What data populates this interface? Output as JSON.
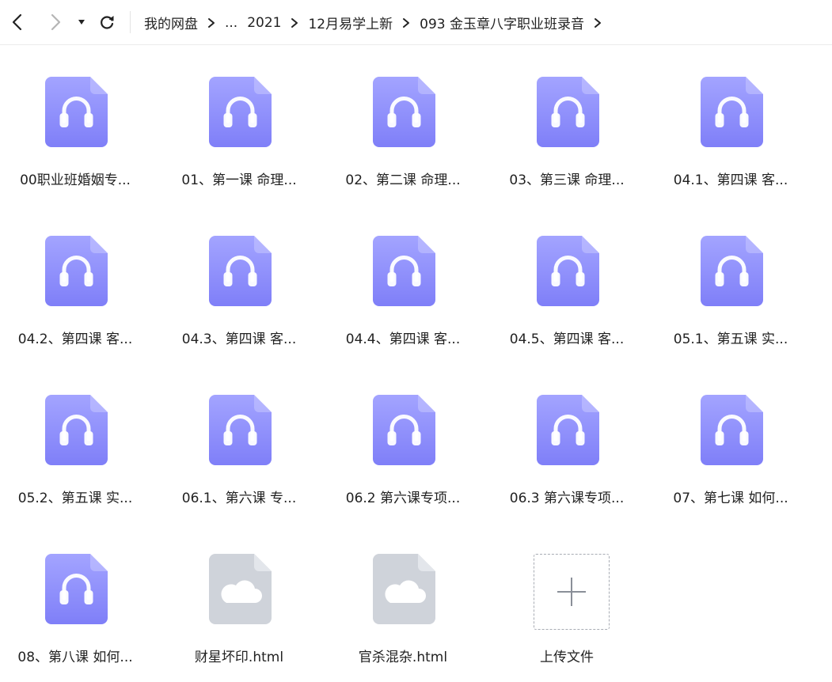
{
  "toolbar": {
    "breadcrumb": {
      "root": "我的网盘",
      "ellipsis": "...",
      "items": [
        "2021",
        "12月易学上新",
        "093 金玉章八字职业班录音"
      ]
    }
  },
  "files": [
    {
      "name": "00职业班婚姻专...",
      "type": "audio"
    },
    {
      "name": "01、第一课 命理...",
      "type": "audio"
    },
    {
      "name": "02、第二课 命理...",
      "type": "audio"
    },
    {
      "name": "03、第三课 命理...",
      "type": "audio"
    },
    {
      "name": "04.1、第四课 客...",
      "type": "audio"
    },
    {
      "name": "04.2、第四课 客...",
      "type": "audio"
    },
    {
      "name": "04.3、第四课 客...",
      "type": "audio"
    },
    {
      "name": "04.4、第四课 客...",
      "type": "audio"
    },
    {
      "name": "04.5、第四课 客...",
      "type": "audio"
    },
    {
      "name": "05.1、第五课 实...",
      "type": "audio"
    },
    {
      "name": "05.2、第五课 实...",
      "type": "audio"
    },
    {
      "name": "06.1、第六课 专...",
      "type": "audio"
    },
    {
      "name": "06.2 第六课专项...",
      "type": "audio"
    },
    {
      "name": "06.3 第六课专项...",
      "type": "audio"
    },
    {
      "name": "07、第七课 如何...",
      "type": "audio"
    },
    {
      "name": "08、第八课 如何...",
      "type": "audio"
    },
    {
      "name": "财星坏印.html",
      "type": "cloud"
    },
    {
      "name": "官杀混杂.html",
      "type": "cloud"
    }
  ],
  "upload": {
    "label": "上传文件"
  },
  "colors": {
    "audio_icon_top": "#a3a4ff",
    "audio_icon_bottom": "#7f7ff8",
    "cloud_icon": "#cfd3da",
    "upload_border": "#a8acb4"
  }
}
